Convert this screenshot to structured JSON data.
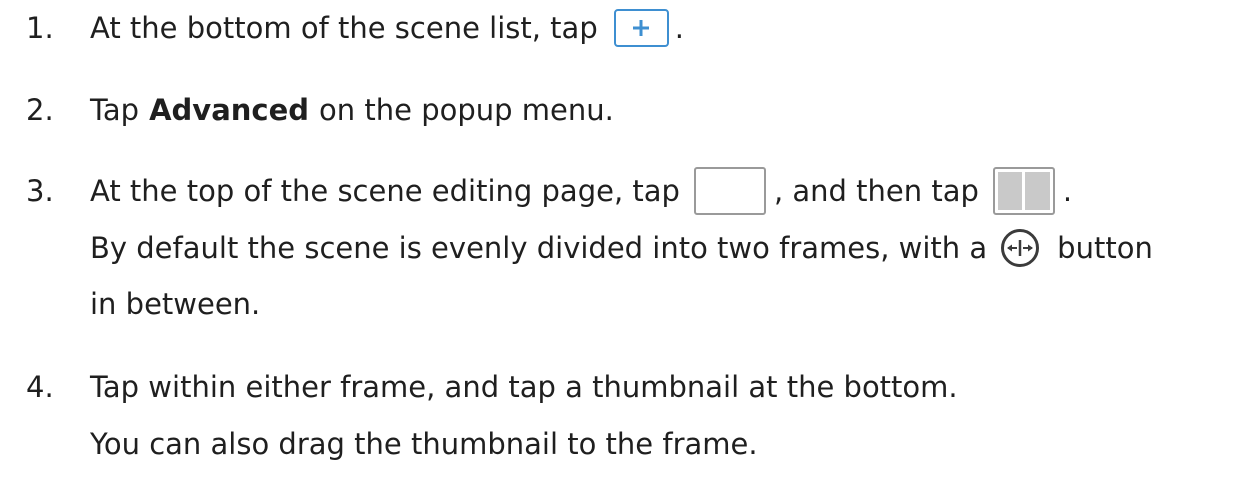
{
  "steps": [
    {
      "number": "1.",
      "text_before": "At the bottom of the scene list, tap",
      "text_after": "."
    },
    {
      "number": "2.",
      "text_before": "Tap",
      "bold": "Advanced",
      "text_after": "on the popup menu."
    },
    {
      "number": "3.",
      "text_before": "At the top of the scene editing page, tap",
      "text_middle": ", and then tap",
      "text_after": ".",
      "detail_before": "By default the scene is evenly divided into two frames, with a",
      "detail_after": "button",
      "detail_line2": "in between."
    },
    {
      "number": "4.",
      "text": "Tap within either frame, and tap a thumbnail at the bottom.",
      "detail": "You can also drag the thumbnail to the frame."
    }
  ],
  "icons": {
    "add": "plus-icon",
    "single_frame": "single-frame-icon",
    "split_frame": "split-frame-icon",
    "divider": "frame-divider-icon"
  },
  "colors": {
    "accent": "#3e8fd1",
    "text": "#1f1f1f",
    "frame_fill": "#c9c9c9"
  }
}
